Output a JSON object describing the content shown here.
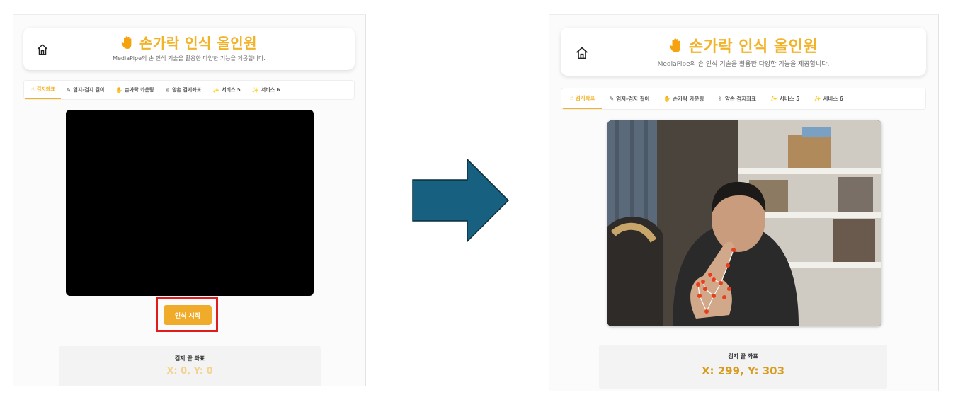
{
  "before": {
    "app_title": "손가락 인식 올인원",
    "subtitle": "MediaPipe의 손 인식 기술을 활용한 다양한 기능을 제공합니다.",
    "tabs": [
      {
        "label": "검지좌표",
        "icon": "☝",
        "active": true
      },
      {
        "label": "엄지-검지 길이",
        "icon": "✎",
        "active": false
      },
      {
        "label": "손가락 카운팅",
        "icon": "✋",
        "active": false
      },
      {
        "label": "양손 검지좌표",
        "icon": "✌",
        "active": false
      },
      {
        "label": "서비스 5",
        "icon": "✨",
        "active": false
      },
      {
        "label": "서비스 6",
        "icon": "✨",
        "active": false
      }
    ],
    "start_button": "인식 시작",
    "coord_label": "검지 끝 좌표",
    "coord_value": "X: 0, Y: 0"
  },
  "after": {
    "app_title": "손가락 인식 올인원",
    "subtitle": "MediaPipe의 손 인식 기술을 활용한 다양한 기능을 제공합니다.",
    "tabs": [
      {
        "label": "검지좌표",
        "icon": "☝",
        "active": true
      },
      {
        "label": "엄지-검지 길이",
        "icon": "✎",
        "active": false
      },
      {
        "label": "손가락 카운팅",
        "icon": "✋",
        "active": false
      },
      {
        "label": "양손 검지좌표",
        "icon": "✌",
        "active": false
      },
      {
        "label": "서비스 5",
        "icon": "✨",
        "active": false
      },
      {
        "label": "서비스 6",
        "icon": "✨",
        "active": false
      }
    ],
    "coord_label": "검지 끝 좌표",
    "coord_value": "X: 299, Y: 303"
  },
  "colors": {
    "accent": "#f0b329",
    "button": "#f0ab2a",
    "highlight": "#e11c1c",
    "arrow": "#17607f"
  }
}
